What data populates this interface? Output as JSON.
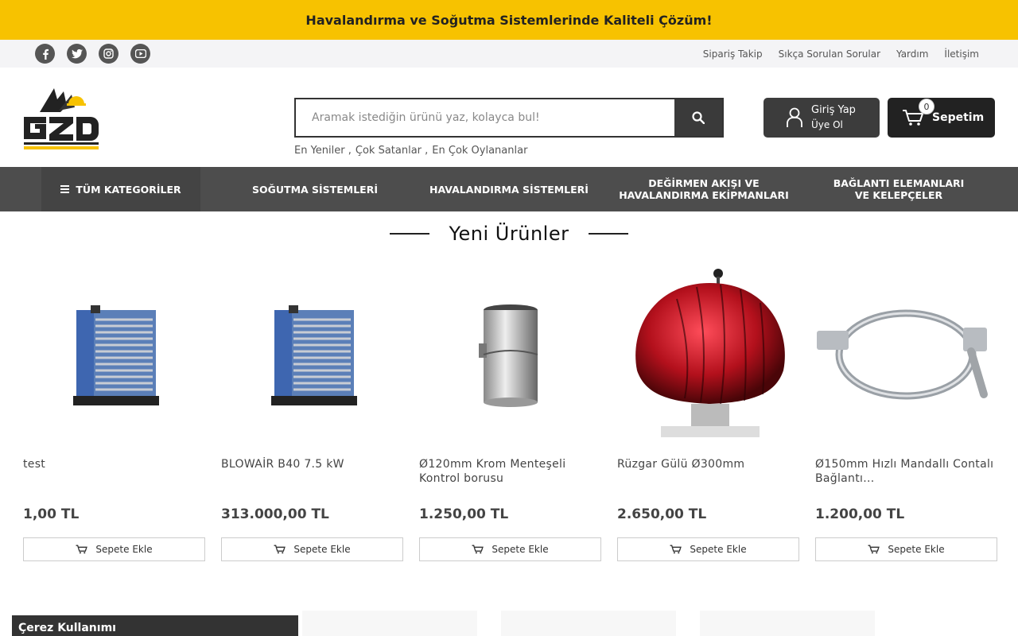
{
  "announcement": "Havalandırma ve Soğutma Sistemlerinde Kaliteli Çözüm!",
  "socials": [
    "facebook-icon",
    "twitter-icon",
    "instagram-icon",
    "youtube-icon"
  ],
  "top_links": [
    "Sipariş Takip",
    "Sıkça Sorulan Sorular",
    "Yardım",
    "İletişim"
  ],
  "search": {
    "placeholder": "Aramak istediğin ürünü yaz, kolayca bul!"
  },
  "quick_links": [
    "En Yeniler ,",
    "Çok Satanlar ,",
    "En Çok Oylananlar"
  ],
  "login": {
    "line1": "Giriş Yap",
    "line2": "Üye Ol"
  },
  "cart": {
    "label": "Sepetim",
    "count": "0"
  },
  "nav": {
    "categories": "TÜM KATEGORİLER",
    "items": [
      "SOĞUTMA SİSTEMLERİ",
      "HAVALANDIRMA SİSTEMLERİ",
      "DEĞİRMEN AKIŞI VE HAVALANDIRMA EKİPMANLARI",
      "BAĞLANTI ELEMANLARI VE KELEPÇELER"
    ]
  },
  "section_title": "Yeni Ürünler",
  "products": [
    {
      "name": "test",
      "price": "1,00 TL",
      "button": "Sepete Ekle"
    },
    {
      "name": "BLOWAİR B40 7.5 kW",
      "price": "313.000,00 TL",
      "button": "Sepete Ekle"
    },
    {
      "name": "Ø120mm Krom Menteşeli Kontrol borusu",
      "price": "1.250,00 TL",
      "button": "Sepete Ekle"
    },
    {
      "name": "Rüzgar Gülü Ø300mm",
      "price": "2.650,00 TL",
      "button": "Sepete Ekle"
    },
    {
      "name": "Ø150mm Hızlı Mandallı Contalı Bağlantı...",
      "price": "1.200,00 TL",
      "button": "Sepete Ekle"
    }
  ],
  "cookie_title": "Çerez Kullanımı",
  "colors": {
    "accent": "#f7c200",
    "nav": "#4d4d4d",
    "dark": "#222222"
  }
}
